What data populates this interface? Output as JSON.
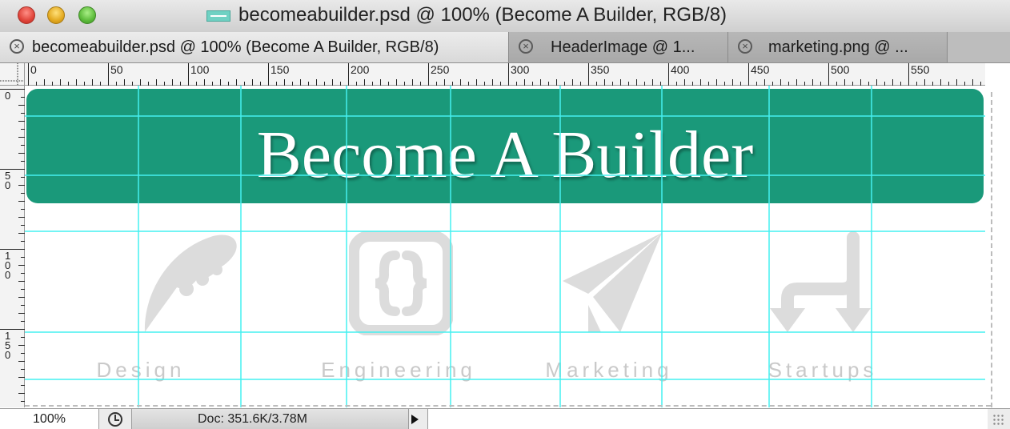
{
  "window": {
    "title": "becomeabuilder.psd @ 100% (Become A Builder, RGB/8)"
  },
  "tabs": [
    {
      "label": "becomeabuilder.psd @ 100% (Become A Builder, RGB/8)",
      "active": true,
      "close_glyph": "×"
    },
    {
      "label": "HeaderImage @ 1...",
      "active": false,
      "close_glyph": "×"
    },
    {
      "label": "marketing.png @ ...",
      "active": false,
      "close_glyph": "×"
    }
  ],
  "ruler": {
    "top_labels": [
      "0",
      "50",
      "100",
      "150",
      "200",
      "250",
      "300",
      "350",
      "400",
      "450",
      "500",
      "550"
    ],
    "left_labels": [
      "0",
      "50",
      "100",
      "150"
    ]
  },
  "canvas": {
    "banner_title": "Become A Builder",
    "banner_color": "#1a997a",
    "guide_color": "#45f0f0",
    "features": [
      {
        "label": "Design",
        "icon": "feather-icon"
      },
      {
        "label": "Engineering",
        "icon": "code-braces-icon"
      },
      {
        "label": "Marketing",
        "icon": "paper-plane-icon"
      },
      {
        "label": "Startups",
        "icon": "branching-arrows-icon"
      }
    ]
  },
  "statusbar": {
    "zoom": "100%",
    "doc_info": "Doc: 351.6K/3.78M"
  }
}
